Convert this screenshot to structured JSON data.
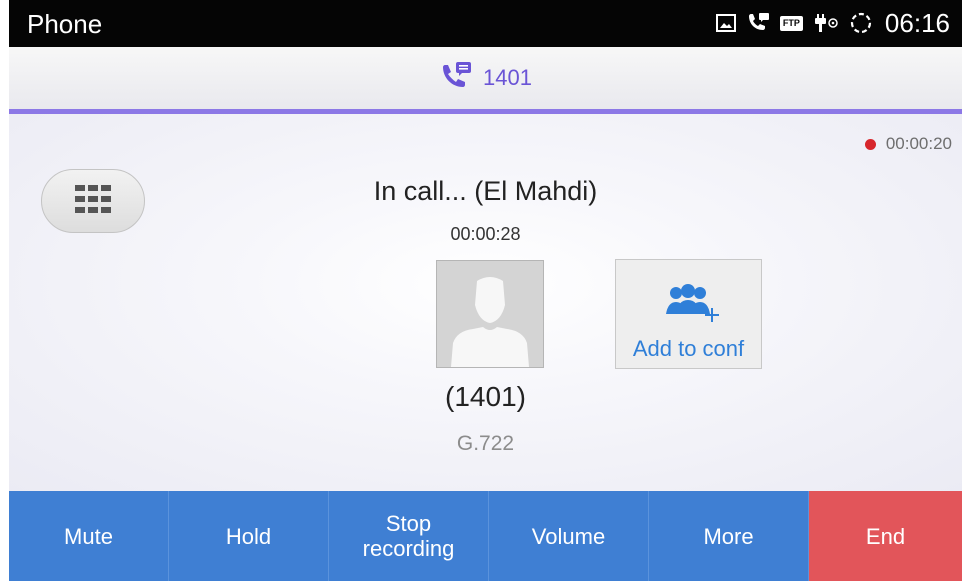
{
  "status_bar": {
    "app_title": "Phone",
    "ftp_badge": "FTP",
    "time": "06:16",
    "icons": [
      "gallery-icon",
      "call-message-icon",
      "ftp-icon",
      "usb-debug-icon",
      "sync-icon"
    ]
  },
  "call_header": {
    "number": "1401",
    "icon": "call-message-icon",
    "accent_color": "#8c78e6"
  },
  "recording": {
    "timer": "00:00:20",
    "dot_color": "#d7262c"
  },
  "call": {
    "status": "In call... (El Mahdi)",
    "duration": "00:00:28",
    "number": "(1401)",
    "codec": "G.722"
  },
  "conference": {
    "label": "Add to conf",
    "icon": "add-conference-icon"
  },
  "keypad": {
    "icon": "keypad-icon"
  },
  "bottom_bar": {
    "mute": "Mute",
    "hold": "Hold",
    "stop_recording_line1": "Stop",
    "stop_recording_line2": "recording",
    "volume": "Volume",
    "more": "More",
    "end": "End",
    "colors": {
      "primary": "#3f7fd3",
      "end": "#e2555a"
    }
  }
}
